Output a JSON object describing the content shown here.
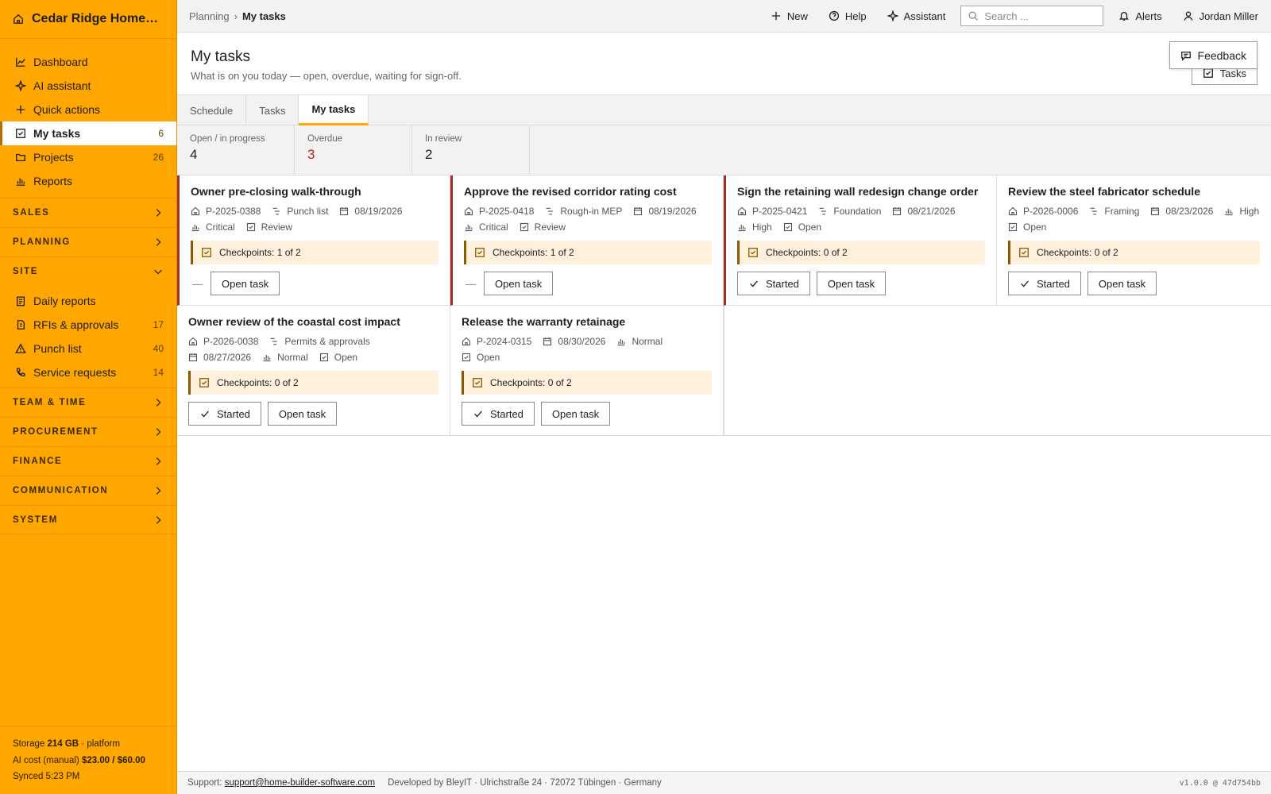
{
  "app": {
    "name": "Cedar Ridge Homes L..."
  },
  "sidebar": {
    "top_items": [
      {
        "label": "Dashboard",
        "icon": "chart-line-icon",
        "count": ""
      },
      {
        "label": "AI assistant",
        "icon": "sparkle-icon",
        "count": ""
      },
      {
        "label": "Quick actions",
        "icon": "plus-icon",
        "count": ""
      },
      {
        "label": "My tasks",
        "icon": "checkbox-icon",
        "count": "6",
        "active": true
      },
      {
        "label": "Projects",
        "icon": "folder-icon",
        "count": "26"
      },
      {
        "label": "Reports",
        "icon": "bar-chart-icon",
        "count": ""
      }
    ],
    "sections": {
      "sales": "SALES",
      "planning": "PLANNING",
      "site": "SITE",
      "team": "TEAM & TIME",
      "procurement": "PROCUREMENT",
      "finance": "FINANCE",
      "communication": "COMMUNICATION",
      "system": "SYSTEM"
    },
    "site_items": [
      {
        "label": "Daily reports",
        "icon": "clipboard-icon",
        "count": ""
      },
      {
        "label": "RFIs & approvals",
        "icon": "document-icon",
        "count": "17"
      },
      {
        "label": "Punch list",
        "icon": "warning-icon",
        "count": "40"
      },
      {
        "label": "Service requests",
        "icon": "phone-icon",
        "count": "14"
      }
    ],
    "footer": {
      "storage_label": "Storage",
      "storage_value": "214 GB",
      "storage_suffix": "· platform",
      "ai_label": "AI cost (manual)",
      "ai_value": "$23.00 / $60.00",
      "synced": "Synced 5:23 PM"
    }
  },
  "topbar": {
    "breadcrumb_parent": "Planning",
    "breadcrumb_sep": "›",
    "breadcrumb_current": "My tasks",
    "new_label": "New",
    "help_label": "Help",
    "assistant_label": "Assistant",
    "search_placeholder": "Search ...",
    "alerts_label": "Alerts",
    "user_name": "Jordan Miller"
  },
  "header": {
    "title": "My tasks",
    "subtitle": "What is on you today — open, overdue, waiting for sign-off.",
    "tasks_button": "Tasks",
    "feedback_button": "Feedback"
  },
  "tabs": [
    "Schedule",
    "Tasks",
    "My tasks"
  ],
  "stats": [
    {
      "label": "Open / in progress",
      "value": "4"
    },
    {
      "label": "Overdue",
      "value": "3",
      "color": "#b3261e"
    },
    {
      "label": "In review",
      "value": "2"
    }
  ],
  "cards": [
    {
      "title": "Owner pre-closing walk-through",
      "project": "P-2025-0388",
      "phase": "Punch list",
      "date": "08/19/2026",
      "priority": "Critical",
      "status": "Review",
      "checkpoints": "Checkpoints: 1 of 2",
      "started": "",
      "open": "Open task",
      "dash": "—"
    },
    {
      "title": "Approve the revised corridor rating cost",
      "project": "P-2025-0418",
      "phase": "Rough-in MEP",
      "date": "08/19/2026",
      "priority": "Critical",
      "status": "Review",
      "checkpoints": "Checkpoints: 1 of 2",
      "started": "",
      "open": "Open task",
      "dash": "—"
    },
    {
      "title": "Sign the retaining wall redesign change order",
      "project": "P-2025-0421",
      "phase": "Foundation",
      "date": "08/21/2026",
      "priority": "High",
      "status": "Open",
      "checkpoints": "Checkpoints: 0 of 2",
      "started": "Started",
      "open": "Open task"
    },
    {
      "title": "Review the steel fabricator schedule",
      "project": "P-2026-0006",
      "phase": "Framing",
      "date": "08/23/2026",
      "priority": "High",
      "status": "Open",
      "checkpoints": "Checkpoints: 0 of 2",
      "started": "Started",
      "open": "Open task"
    },
    {
      "title": "Owner review of the coastal cost impact",
      "project": "P-2026-0038",
      "phase": "Permits & approvals",
      "date": "08/27/2026",
      "priority": "Normal",
      "status": "Open",
      "checkpoints": "Checkpoints: 0 of 2",
      "started": "Started",
      "open": "Open task"
    },
    {
      "title": "Release the warranty retainage",
      "project": "P-2024-0315",
      "phase": "",
      "date": "08/30/2026",
      "priority": "Normal",
      "status": "Open",
      "checkpoints": "Checkpoints: 0 of 2",
      "started": "Started",
      "open": "Open task"
    }
  ],
  "footer": {
    "support_label": "Support:",
    "support_email": "support@home-builder-software.com",
    "developer": "Developed by BleyIT · Ulrichstraße 24 · 72072 Tübingen · Germany",
    "version": "v1.0.0 @ 47d754bb"
  },
  "colors": {
    "sidebar": "#ffa600",
    "overdue": "#b3261e",
    "checkpoint_bg": "#fff1dc",
    "accent": "#ffa600"
  }
}
